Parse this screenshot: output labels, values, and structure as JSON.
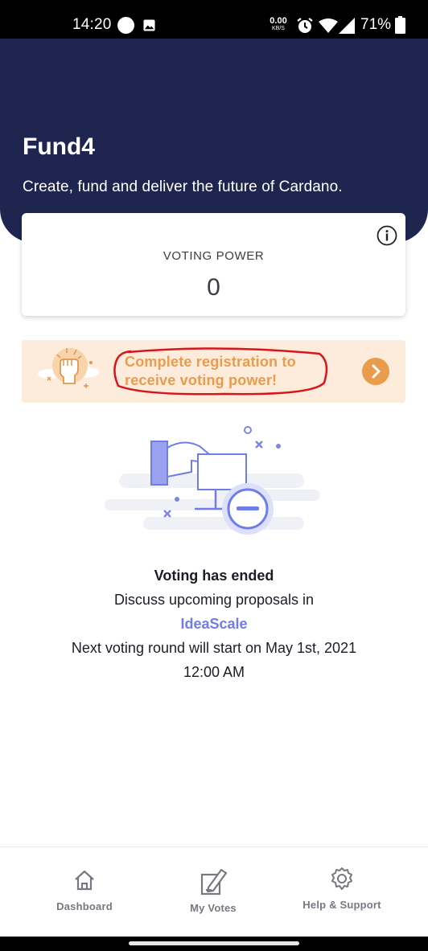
{
  "status_bar": {
    "time": "14:20",
    "net_speed_value": "0.00",
    "net_speed_unit": "KB/S",
    "battery_percent": "71%",
    "icons": [
      "circle-dot-icon",
      "image-icon",
      "alarm-icon",
      "wifi-icon",
      "cell-signal-icon",
      "battery-icon"
    ]
  },
  "header": {
    "title": "Fund4",
    "subtitle": "Create, fund and deliver the future of Cardano."
  },
  "voting_power": {
    "label": "VOTING POWER",
    "value": "0",
    "info_icon": "info-icon"
  },
  "registration": {
    "text": "Complete registration to receive voting power!",
    "arrow_icon": "chevron-right-icon",
    "accent_color": "#ea9c4d",
    "annotation_color": "#d9141b"
  },
  "voting_status": {
    "title": "Voting has ended",
    "line1": "Discuss upcoming proposals in",
    "link": "IdeaScale",
    "line2": "Next voting round will start on May 1st, 2021",
    "line3": "12:00 AM"
  },
  "bottom_nav": {
    "items": [
      {
        "label": "Dashboard",
        "icon": "home-icon"
      },
      {
        "label": "My Votes",
        "icon": "ballot-icon"
      },
      {
        "label": "Help & Support",
        "icon": "gear-icon"
      }
    ]
  },
  "colors": {
    "header_bg": "#1e2650",
    "link": "#6f7de8",
    "banner_bg": "#fdecdc",
    "text": "#1c1c28"
  }
}
